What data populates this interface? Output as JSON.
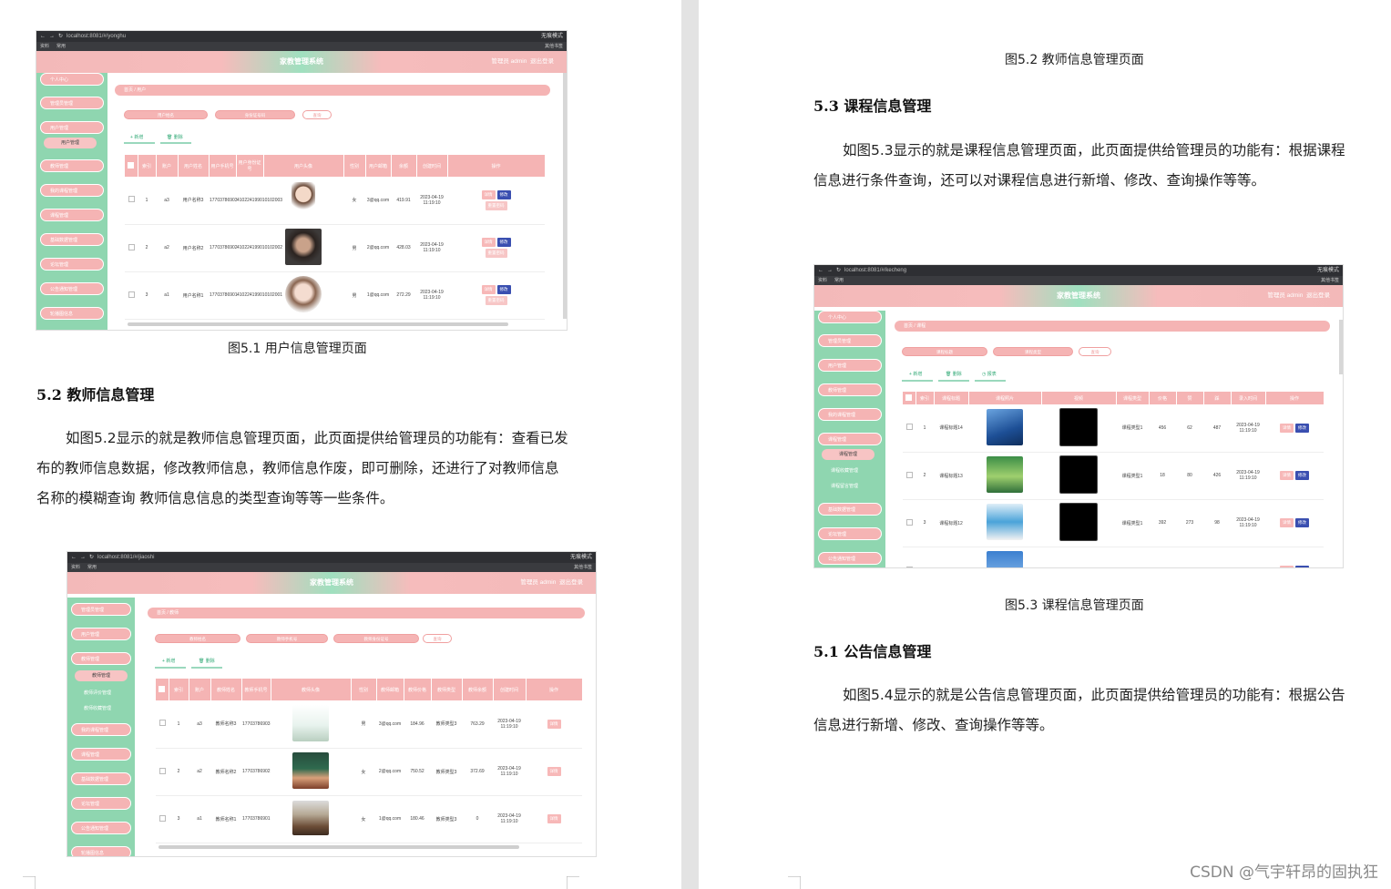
{
  "watermark": "CSDN @气宇轩昂的固执狂",
  "left_page": {
    "fig1": {
      "caption": "图5.1  用户信息管理页面",
      "screenshot": {
        "url": "localhost:8081/#/yonghu",
        "incognito": "无痕模式",
        "bookmarks": [
          "资料",
          "常用"
        ],
        "other_bookmarks": "其他书签",
        "app_title": "家教管理系统",
        "admin": "管理员 admin",
        "logout": "退出登录",
        "sidebar": [
          "个人中心",
          "管理员管理",
          "用户管理",
          "教师管理",
          "我的课程管理",
          "课程管理",
          "基础数据管理",
          "论坛管理",
          "公告通知管理",
          "轮播图信息"
        ],
        "submenu": "用户管理",
        "breadcrumb": "首页 / 用户",
        "search_fields": [
          "用户姓名",
          "身份证号码",
          "查询"
        ],
        "actions": [
          "新增",
          "删除"
        ],
        "columns": [
          "",
          "索引",
          "账户",
          "用户姓名",
          "用户手机号",
          "用户身份证号",
          "用户头像",
          "性别",
          "用户邮箱",
          "余额",
          "创建时间",
          "操作"
        ],
        "rows": [
          [
            "1",
            "a3",
            "用户名称3",
            "17703786903",
            "410224199010102003",
            "女",
            "3@qq.com",
            "419.91",
            "2023-04-19 11:19:10"
          ],
          [
            "2",
            "a2",
            "用户名称2",
            "17703786902",
            "410224199010102002",
            "男",
            "2@qq.com",
            "428.03",
            "2023-04-19 11:19:10"
          ],
          [
            "3",
            "a1",
            "用户名称1",
            "17703786901",
            "410224199010102001",
            "男",
            "1@qq.com",
            "272.29",
            "2023-04-19 11:19:10"
          ]
        ],
        "btn_detail": "详情",
        "btn_edit": "修改",
        "btn_reset": "重置密码"
      }
    },
    "section": {
      "heading": "5.2  教师信息管理",
      "paragraph": "如图5.2显示的就是教师信息管理页面，此页面提供给管理员的功能有：查看已发布的教师信息数据，修改教师信息，教师信息作废，即可删除，还进行了对教师信息名称的模糊查询  教师信息信息的类型查询等等一些条件。"
    },
    "fig2": {
      "screenshot": {
        "url": "localhost:8081/#/jiaoshi",
        "incognito": "无痕模式",
        "bookmarks": [
          "资料",
          "常用"
        ],
        "other_bookmarks": "其他书签",
        "app_title": "家教管理系统",
        "admin": "管理员 admin",
        "logout": "退出登录",
        "sidebar": [
          "管理员管理",
          "用户管理",
          "教师管理",
          "我的课程管理",
          "课程管理",
          "基础数据管理",
          "论坛管理",
          "公告通知管理",
          "轮播图信息"
        ],
        "submenu": [
          "教师管理",
          "教师评价管理",
          "教师收藏管理"
        ],
        "breadcrumb": "首页 / 教师",
        "search_fields": [
          "教师姓名",
          "教师手机号",
          "教师身份证号",
          "查询"
        ],
        "actions": [
          "新增",
          "删除"
        ],
        "columns": [
          "",
          "索引",
          "账户",
          "教师姓名",
          "教师手机号",
          "教师头像",
          "性别",
          "教师邮箱",
          "教师价格",
          "教师类型",
          "教师余额",
          "创建时间",
          "操作"
        ],
        "rows": [
          [
            "1",
            "a3",
            "教师名称3",
            "17703786903",
            "男",
            "3@qq.com",
            "184.96",
            "教师类型3",
            "763.29",
            "2023-04-19 11:19:10"
          ],
          [
            "2",
            "a2",
            "教师名称2",
            "17703786902",
            "女",
            "2@qq.com",
            "750.52",
            "教师类型3",
            "372.69",
            "2023-04-19 11:19:10"
          ],
          [
            "3",
            "a1",
            "教师名称1",
            "17703786901",
            "女",
            "1@qq.com",
            "180.46",
            "教师类型3",
            "0",
            "2023-04-19 11:19:10"
          ]
        ],
        "btn_detail": "详情"
      }
    }
  },
  "right_page": {
    "fig2_caption": "图5.2  教师信息管理页面",
    "section1": {
      "heading": "5.3 课程信息管理",
      "paragraph": "如图5.3显示的就是课程信息管理页面，此页面提供给管理员的功能有：根据课程信息进行条件查询，还可以对课程信息进行新增、修改、查询操作等等。"
    },
    "fig3": {
      "caption": "图5.3  课程信息管理页面",
      "screenshot": {
        "url": "localhost:8081/#/kecheng",
        "incognito": "无痕模式",
        "bookmarks": [
          "资料",
          "常用"
        ],
        "other_bookmarks": "其他书签",
        "app_title": "家教管理系统",
        "admin": "管理员 admin",
        "logout": "退出登录",
        "sidebar_top": [
          "个人中心",
          "管理员管理",
          "用户管理",
          "教师管理",
          "我的课程管理",
          "课程管理"
        ],
        "submenu": [
          "课程管理",
          "课程收藏管理",
          "课程留言管理"
        ],
        "sidebar_bottom": [
          "基础数据管理",
          "论坛管理",
          "公告通知管理"
        ],
        "breadcrumb": "首页 / 课程",
        "search_fields": [
          "课程标题",
          "课程类型",
          "查询"
        ],
        "actions": [
          "新增",
          "删除",
          "报表"
        ],
        "columns": [
          "",
          "索引",
          "课程标题",
          "课程照片",
          "视频",
          "课程类型",
          "价格",
          "赞",
          "踩",
          "录入时间",
          "操作"
        ],
        "rows": [
          [
            "1",
            "课程标题14",
            "课程类型1",
            "456",
            "62",
            "487",
            "2023-04-19 11:19:10"
          ],
          [
            "2",
            "课程标题13",
            "课程类型1",
            "18",
            "80",
            "426",
            "2023-04-19 11:19:10"
          ],
          [
            "3",
            "课程标题12",
            "课程类型1",
            "392",
            "273",
            "98",
            "2023-04-19 11:19:10"
          ],
          [
            "",
            "课程标题",
            "课程类型",
            "",
            "",
            "",
            "2023-04"
          ]
        ],
        "btn_detail": "详情",
        "btn_edit": "修改"
      }
    },
    "section2": {
      "heading": "5.1 公告信息管理",
      "paragraph": "如图5.4显示的就是公告信息管理页面，此页面提供给管理员的功能有：根据公告信息进行新增、修改、查询操作等等。"
    }
  }
}
